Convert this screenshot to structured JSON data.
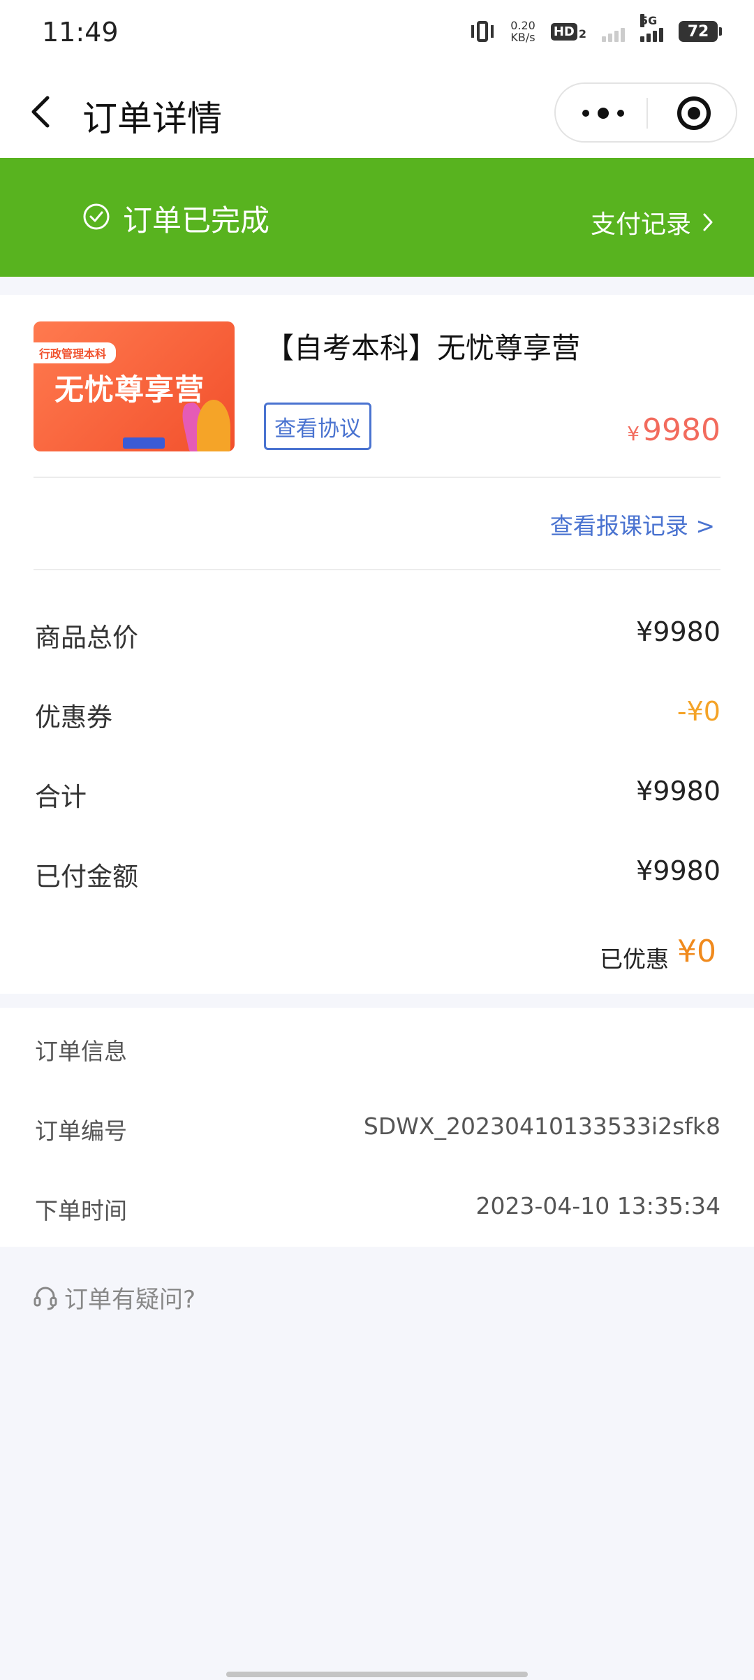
{
  "status_bar": {
    "time": "11:49",
    "speed_value": "0.20",
    "speed_unit": "KB/s",
    "hd_label": "HD",
    "hd_sub": "2",
    "network": "5G",
    "battery": "72"
  },
  "nav": {
    "title": "订单详情"
  },
  "banner": {
    "status": "订单已完成",
    "pay_record_link": "支付记录",
    "color": "#58b31f"
  },
  "product": {
    "thumb_tag": "行政管理本科",
    "thumb_title": "无忧尊享营",
    "title": "【自考本科】无忧尊享营",
    "agreement_button": "查看协议",
    "currency": "¥",
    "price": "9980"
  },
  "record_link": "查看报课记录 >",
  "price_summary": [
    {
      "label": "商品总价",
      "value": "¥9980"
    },
    {
      "label": "优惠券",
      "value": "-¥0"
    },
    {
      "label": "合计",
      "value": "¥9980"
    },
    {
      "label": "已付金额",
      "value": "¥9980"
    }
  ],
  "discount": {
    "label": "已优惠",
    "value": "¥0"
  },
  "order_info": {
    "heading": "订单信息",
    "number_label": "订单编号",
    "number_value": "SDWX_20230410133533i2sfk8",
    "time_label": "下单时间",
    "time_value": "2023-04-10 13:35:34"
  },
  "help": {
    "text": "订单有疑问?"
  },
  "colors": {
    "link_blue": "#4a73d0",
    "price_red": "#f26b5d",
    "coupon_orange": "#f4a327",
    "discount_orange": "#f08a1d"
  }
}
